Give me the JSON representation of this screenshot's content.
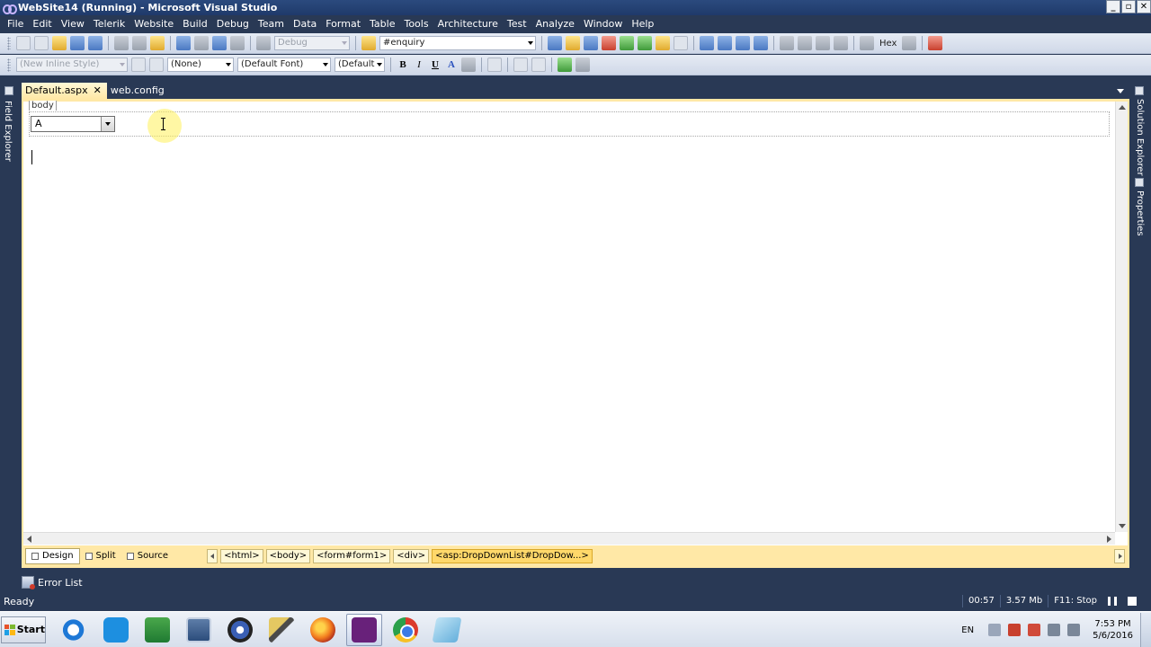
{
  "window": {
    "title": "WebSite14 (Running) - Microsoft Visual Studio",
    "controls": [
      "_",
      "▫",
      "✕"
    ]
  },
  "menu": [
    "File",
    "Edit",
    "View",
    "Telerik",
    "Website",
    "Build",
    "Debug",
    "Team",
    "Data",
    "Format",
    "Table",
    "Tools",
    "Architecture",
    "Test",
    "Analyze",
    "Window",
    "Help"
  ],
  "toolbar1": {
    "config_dropdown": "Debug",
    "find_dropdown": "#enquiry",
    "hex_label": "Hex"
  },
  "toolbar2": {
    "style_dropdown": "(New Inline Style)",
    "block_dropdown": "(None)",
    "font_dropdown": "(Default Font)",
    "size_dropdown": "(Default",
    "bold": "B",
    "italic": "I",
    "underline": "U",
    "font_color": "A"
  },
  "side_panels": {
    "left": "Field Explorer",
    "right_top": "Solution Explorer",
    "right_bottom": "Properties"
  },
  "tabs": [
    {
      "label": "Default.aspx",
      "close": "✕"
    },
    {
      "label": "web.config"
    }
  ],
  "editor": {
    "body_tag": "body",
    "dropdown_value": "A"
  },
  "view_tabs": {
    "design": "Design",
    "split": "Split",
    "source": "Source"
  },
  "breadcrumbs": [
    "<html>",
    "<body>",
    "<form#form1>",
    "<div>",
    "<asp:DropDownList#DropDow...>"
  ],
  "error_list": "Error List",
  "status": {
    "ready": "Ready",
    "time": "00:57",
    "memory": "3.57 Mb",
    "hint": "F11: Stop"
  },
  "taskbar": {
    "start": "Start",
    "language": "EN",
    "time": "7:53 PM",
    "date": "5/6/2016"
  }
}
